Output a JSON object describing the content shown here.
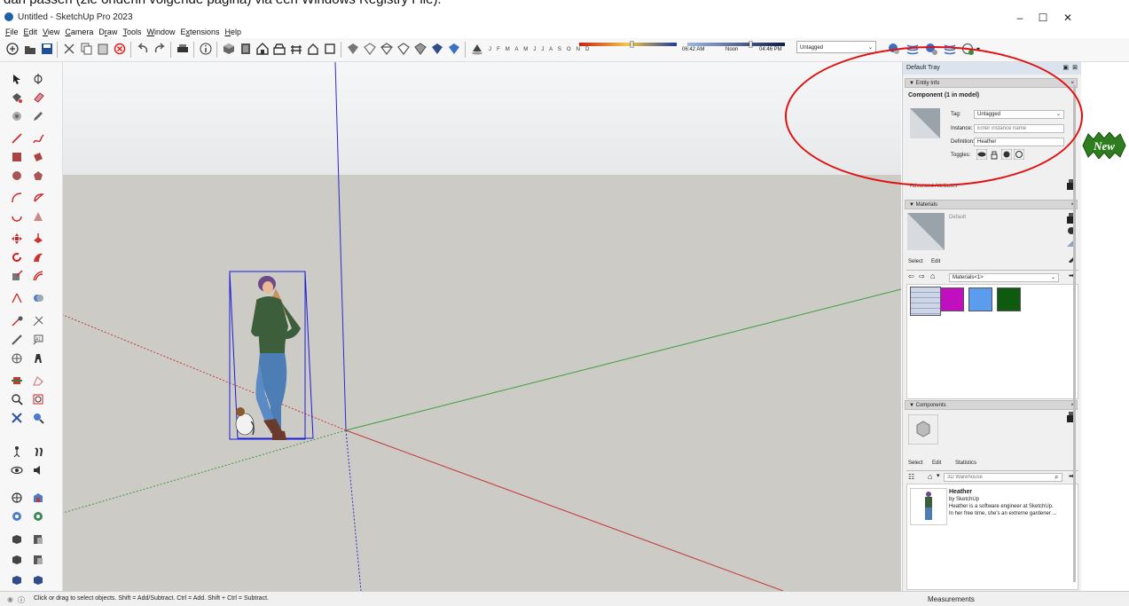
{
  "doc_header_text": "dan passen (zie onderin volgende pagina) via een Windows Registry File).",
  "window": {
    "title": "Untitled - SketchUp Pro 2023",
    "minimize": "–",
    "maximize": "☐",
    "close": "✕"
  },
  "menu": [
    {
      "pre": "",
      "u": "F",
      "post": "ile"
    },
    {
      "pre": "",
      "u": "E",
      "post": "dit"
    },
    {
      "pre": "",
      "u": "V",
      "post": "iew"
    },
    {
      "pre": "",
      "u": "C",
      "post": "amera"
    },
    {
      "pre": "D",
      "u": "r",
      "post": "aw"
    },
    {
      "pre": "",
      "u": "T",
      "post": "ools"
    },
    {
      "pre": "",
      "u": "W",
      "post": "indow"
    },
    {
      "pre": "E",
      "u": "x",
      "post": "tensions"
    },
    {
      "pre": "",
      "u": "H",
      "post": "elp"
    }
  ],
  "shadow": {
    "months": "J F M A M J J A S O N D",
    "time_start": "06:42 AM",
    "time_noon": "Noon",
    "time_end": "04:46 PM"
  },
  "tag_dropdown": "Untagged",
  "tray": {
    "title": "Default Tray",
    "entity_info": {
      "header": "Entity Info",
      "component": "Component (1 in model)",
      "tag_label": "Tag:",
      "tag_value": "Untagged",
      "instance_label": "Instance:",
      "instance_placeholder": "Enter instance name",
      "definition_label": "Definition:",
      "definition_value": "Heather",
      "toggles_label": "Toggles:",
      "advanced": "Advanced Attributes"
    },
    "materials": {
      "header": "Materials",
      "default": "Default",
      "tab_select": "Select",
      "tab_edit": "Edit",
      "dropdown": "Materials<1>",
      "swatches": [
        "#c10fbf",
        "#5c9cef",
        "#0f5a0f"
      ]
    },
    "components": {
      "header": "Components",
      "tab_select": "Select",
      "tab_edit": "Edit",
      "tab_stats": "Statistics",
      "search_placeholder": "3D Warehouse",
      "item_title": "Heather",
      "item_by": "by SketchUp",
      "item_desc1": "Heather is a software engineer at SketchUp.",
      "item_desc2": "In her free time, she's an extreme gardener ..."
    }
  },
  "status": {
    "message": "Click or drag to select objects. Shift = Add/Subtract. Ctrl = Add. Shift + Ctrl = Subtract.",
    "measurements": "Measurements"
  },
  "badge": "New",
  "colors": {
    "axis_red": "#c33a3a",
    "axis_green": "#3c9d3c",
    "axis_blue": "#2a2ad0",
    "selection": "#1b1bd6",
    "annotation": "#e01010",
    "badge": "#2e7d1e"
  }
}
